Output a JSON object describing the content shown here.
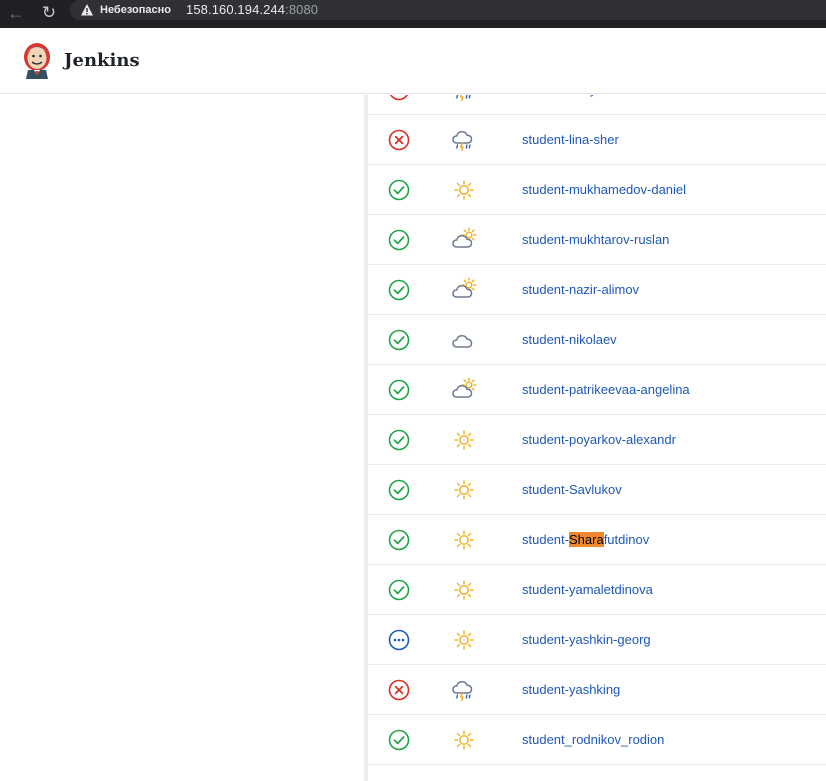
{
  "browser": {
    "insecure_label": "Небезопасно",
    "url_host": "158.160.194.244",
    "url_port": ":8080"
  },
  "header": {
    "brand": "Jenkins"
  },
  "colors": {
    "link": "#1d58b8",
    "success": "#1ea446",
    "failure": "#d92d20",
    "running": "#1d58b8",
    "sun": "#f0b429",
    "cloud": "#6b7a90",
    "highlight": "#f0892e"
  },
  "jobs": [
    {
      "name_before": "student-khaymuh",
      "name_hl": "",
      "name_after": "",
      "status": "failure",
      "weather": "storm"
    },
    {
      "name_before": "student-lina-sher",
      "name_hl": "",
      "name_after": "",
      "status": "failure",
      "weather": "storm"
    },
    {
      "name_before": "student-mukhamedov-daniel",
      "name_hl": "",
      "name_after": "",
      "status": "success",
      "weather": "sunny"
    },
    {
      "name_before": "student-mukhtarov-ruslan",
      "name_hl": "",
      "name_after": "",
      "status": "success",
      "weather": "partly-cloudy"
    },
    {
      "name_before": "student-nazir-alimov",
      "name_hl": "",
      "name_after": "",
      "status": "success",
      "weather": "partly-cloudy"
    },
    {
      "name_before": "student-nikolaev",
      "name_hl": "",
      "name_after": "",
      "status": "success",
      "weather": "cloudy"
    },
    {
      "name_before": "student-patrikeevaa-angelina",
      "name_hl": "",
      "name_after": "",
      "status": "success",
      "weather": "partly-cloudy"
    },
    {
      "name_before": "student-poyarkov-alexandr",
      "name_hl": "",
      "name_after": "",
      "status": "success",
      "weather": "sunny"
    },
    {
      "name_before": "student-Savlukov",
      "name_hl": "",
      "name_after": "",
      "status": "success",
      "weather": "sunny"
    },
    {
      "name_before": "student-",
      "name_hl": "Shara",
      "name_after": "futdinov",
      "status": "success",
      "weather": "sunny"
    },
    {
      "name_before": "student-yamaletdinova",
      "name_hl": "",
      "name_after": "",
      "status": "success",
      "weather": "sunny"
    },
    {
      "name_before": "student-yashkin-georg",
      "name_hl": "",
      "name_after": "",
      "status": "running",
      "weather": "sunny"
    },
    {
      "name_before": "student-yashking",
      "name_hl": "",
      "name_after": "",
      "status": "failure",
      "weather": "storm"
    },
    {
      "name_before": "student_rodnikov_rodion",
      "name_hl": "",
      "name_after": "",
      "status": "success",
      "weather": "sunny"
    }
  ]
}
